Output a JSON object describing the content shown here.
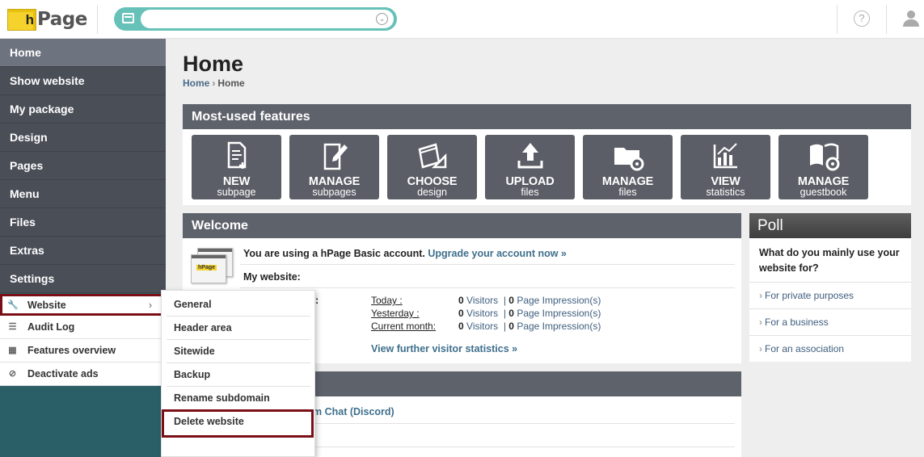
{
  "header": {
    "logo_box": "h",
    "logo_text": "Page",
    "search": {
      "value": "",
      "placeholder": ""
    },
    "help_symbol": "?",
    "search_icon": "window-icon",
    "dropdown_icon": "chevron-down-icon",
    "help_icon": "help-icon",
    "user_icon": "user-icon"
  },
  "sidebar": {
    "main_items": [
      {
        "label": "Home",
        "active": true
      },
      {
        "label": "Show website"
      },
      {
        "label": "My package"
      },
      {
        "label": "Design"
      },
      {
        "label": "Pages"
      },
      {
        "label": "Menu"
      },
      {
        "label": "Files"
      },
      {
        "label": "Extras"
      },
      {
        "label": "Settings"
      }
    ],
    "sub_items": [
      {
        "label": "Website",
        "icon": "wrench-icon",
        "arrow": "›",
        "selected": true
      },
      {
        "label": "Audit Log",
        "icon": "list-icon"
      },
      {
        "label": "Features overview",
        "icon": "grid-icon"
      },
      {
        "label": "Deactivate ads",
        "icon": "block-icon"
      }
    ]
  },
  "flyout": {
    "items": [
      {
        "label": "General"
      },
      {
        "label": "Header area"
      },
      {
        "label": "Sitewide"
      },
      {
        "label": "Backup"
      },
      {
        "label": "Rename subdomain"
      },
      {
        "label": "Delete website",
        "selected": true
      }
    ]
  },
  "main": {
    "title": "Home",
    "breadcrumb": {
      "link": "Home",
      "separator": "›",
      "current": "Home"
    },
    "features": {
      "heading": "Most-used features",
      "items": [
        {
          "line1": "NEW",
          "line2": "subpage",
          "icon": "new-page-icon"
        },
        {
          "line1": "MANAGE",
          "line2": "subpages",
          "icon": "edit-page-icon"
        },
        {
          "line1": "CHOOSE",
          "line2": "design",
          "icon": "design-icon"
        },
        {
          "line1": "UPLOAD",
          "line2": "files",
          "icon": "upload-icon"
        },
        {
          "line1": "MANAGE",
          "line2": "files",
          "icon": "folder-gear-icon"
        },
        {
          "line1": "VIEW",
          "line2": "statistics",
          "icon": "statistics-icon"
        },
        {
          "line1": "MANAGE",
          "line2": "guestbook",
          "icon": "book-gear-icon"
        }
      ]
    },
    "welcome": {
      "heading": "Welcome",
      "account_text": "You are using a hPage Basic account.",
      "upgrade_link": "Upgrade your account now »",
      "thumb_label": "hPage",
      "my_website_label": "My website:",
      "stats_fragment": "s:",
      "stats": [
        {
          "label": "Today :",
          "visitors": "0",
          "visitors_label": "Visitors",
          "impressions": "0",
          "impressions_label": "Page Impression(s)"
        },
        {
          "label": "Yesterday :",
          "visitors": "0",
          "visitors_label": "Visitors",
          "impressions": "0",
          "impressions_label": "Page Impression(s)"
        },
        {
          "label": "Current month:",
          "visitors": "0",
          "visitors_label": "Visitors",
          "impressions": "0",
          "impressions_label": "Page Impression(s)"
        }
      ],
      "further_link": "View further visitor statistics »"
    },
    "third_box": {
      "chat_link": "m Chat (Discord)"
    },
    "poll": {
      "heading": "Poll",
      "question": "What do you mainly use your website for?",
      "options": [
        {
          "label": "For private purposes"
        },
        {
          "label": "For a business"
        },
        {
          "label": "For an association"
        }
      ],
      "arrow": "›"
    }
  }
}
